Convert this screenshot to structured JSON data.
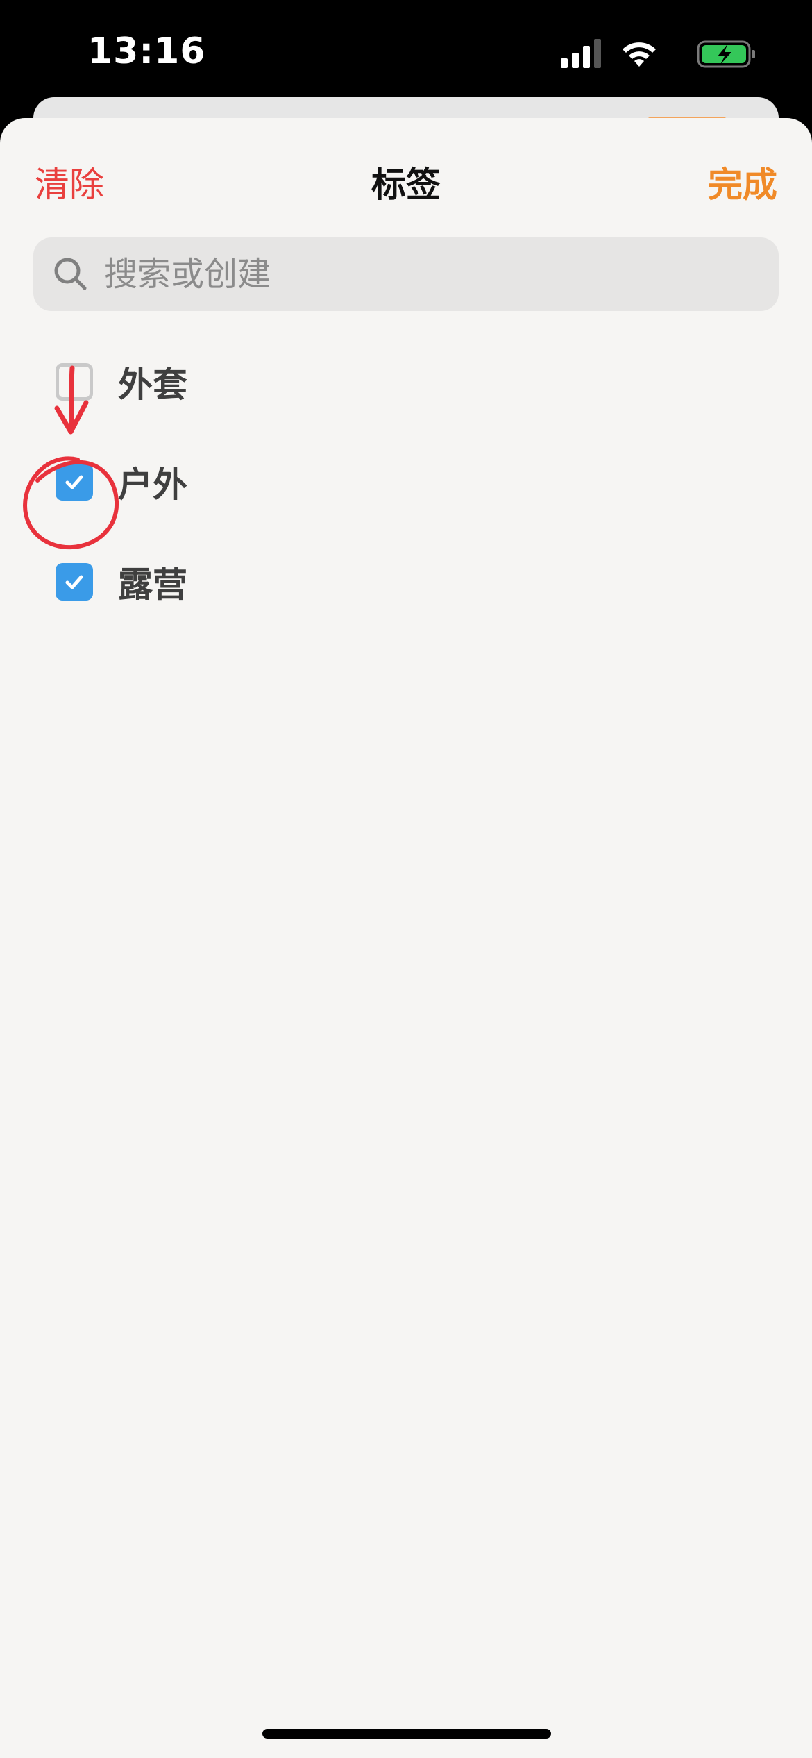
{
  "status_bar": {
    "time": "13:16",
    "icons": [
      "signal-icon",
      "wifi-icon",
      "battery-charging-icon"
    ],
    "battery_color": "#34c759"
  },
  "sheet": {
    "clear_label": "清除",
    "title": "标签",
    "done_label": "完成"
  },
  "search": {
    "placeholder": "搜索或创建",
    "value": ""
  },
  "tags": [
    {
      "label": "外套",
      "checked": false
    },
    {
      "label": "户外",
      "checked": true
    },
    {
      "label": "露营",
      "checked": true
    }
  ],
  "colors": {
    "clear": "#e9403e",
    "done": "#f08a28",
    "checkbox": "#3a9be8",
    "annotation": "#e8323c"
  }
}
